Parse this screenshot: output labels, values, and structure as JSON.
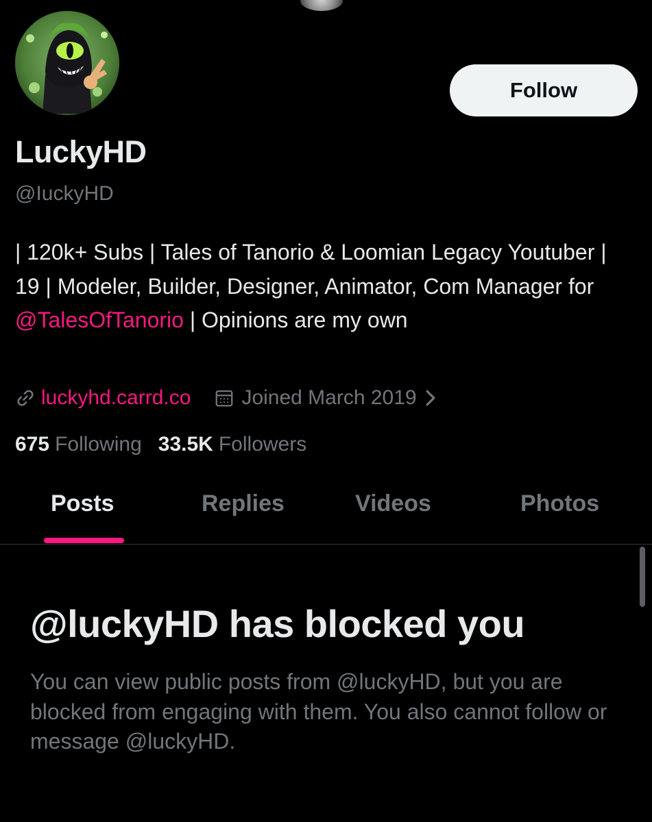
{
  "colors": {
    "background": "#000000",
    "text_primary": "#e7e9ea",
    "text_secondary": "#71767b",
    "accent": "#f91880",
    "follow_button_bg": "#eff3f4",
    "divider": "#2f3336"
  },
  "profile": {
    "avatar_icon": "profile-avatar-cartoon",
    "display_name": "LuckyHD",
    "handle": "@IuckyHD",
    "follow_label": "Follow",
    "bio": {
      "part1": "| 120k+ Subs | Tales of Tanorio & Loomian Legacy Youtuber | 19 | Modeler, Builder, Designer, Animator, Com Manager for ",
      "mention": "@TalesOfTanorio",
      "part2": " | Opinions are my own"
    },
    "link": {
      "icon": "link-icon",
      "text": "luckyhd.carrd.co"
    },
    "joined": {
      "icon": "calendar-icon",
      "text": "Joined March 2019",
      "chevron_icon": "chevron-right-icon"
    },
    "following": {
      "count": "675",
      "label": "Following"
    },
    "followers": {
      "count": "33.5K",
      "label": "Followers"
    }
  },
  "tabs": [
    {
      "label": "Posts",
      "active": true
    },
    {
      "label": "Replies",
      "active": false
    },
    {
      "label": "Videos",
      "active": false
    },
    {
      "label": "Photos",
      "active": false
    }
  ],
  "blocked": {
    "title": "@luckyHD has blocked you",
    "message": "You can view public posts from @luckyHD, but you are blocked from engaging with them. You also cannot follow or message @luckyHD."
  }
}
